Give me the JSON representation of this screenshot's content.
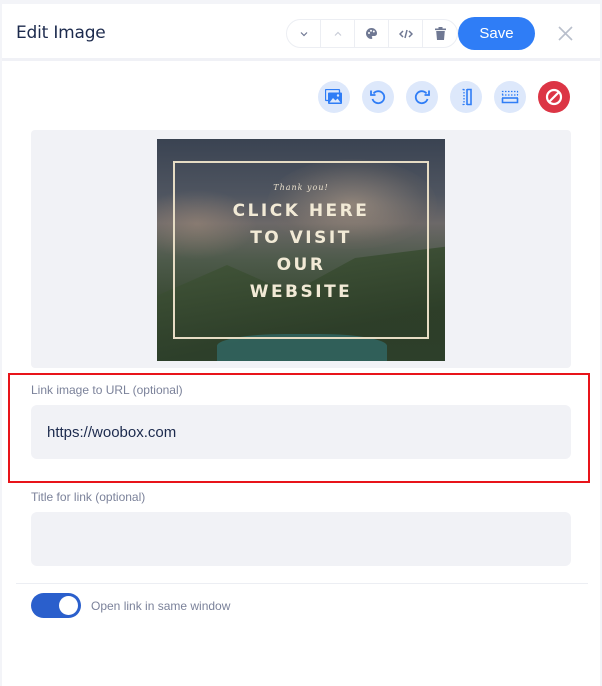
{
  "header": {
    "title": "Edit Image",
    "save_label": "Save",
    "group_buttons": [
      {
        "icon": "chevron-down-icon"
      },
      {
        "icon": "chevron-up-icon"
      },
      {
        "icon": "palette-icon"
      },
      {
        "icon": "code-icon"
      },
      {
        "icon": "trash-icon"
      }
    ],
    "close_icon": "close-icon"
  },
  "toolbar": {
    "buttons": [
      {
        "name": "replace-image",
        "icon": "image-icon"
      },
      {
        "name": "rotate-left",
        "icon": "rotate-left-icon"
      },
      {
        "name": "rotate-right",
        "icon": "rotate-right-icon"
      },
      {
        "name": "flip-horizontal",
        "icon": "flip-horizontal-icon"
      },
      {
        "name": "flip-vertical",
        "icon": "flip-vertical-icon"
      },
      {
        "name": "remove-image",
        "icon": "ban-icon"
      }
    ]
  },
  "image": {
    "thanks": "Thank you!",
    "lines": [
      "CLICK HERE",
      "TO VISIT",
      "OUR",
      "WEBSITE"
    ]
  },
  "form": {
    "url_label": "Link image to URL (optional)",
    "url_value": "https://woobox.com",
    "title_label": "Title for link (optional)",
    "title_value": "",
    "toggle_label": "Open link in same window",
    "toggle_on": true
  },
  "colors": {
    "accent": "#2f7df6",
    "danger": "#dc3545",
    "toggle": "#2a5fcc",
    "highlight": "#e8141a"
  }
}
